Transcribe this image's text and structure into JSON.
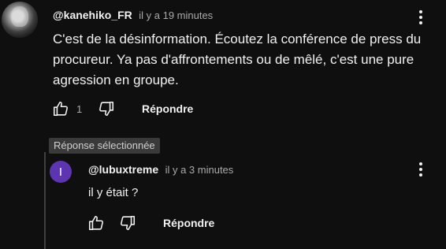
{
  "comment": {
    "author": "@kanehiko_FR",
    "timestamp": "il y a 19 minutes",
    "text_line1": "C'est de la désinformation. Écoutez la conférence de press du",
    "text_line2": "procureur. Ya pas d'affrontements ou de mêlé, c'est une pure",
    "text_line3": "agression en groupe.",
    "like_count": "1",
    "reply_label": "Répondre"
  },
  "reply": {
    "badge": "Réponse sélectionnée",
    "avatar_letter": "I",
    "avatar_color": "#5e35b1",
    "author": "@lubuxtreme",
    "timestamp": "il y a 3 minutes",
    "text": "il y était ?",
    "reply_label": "Répondre"
  }
}
